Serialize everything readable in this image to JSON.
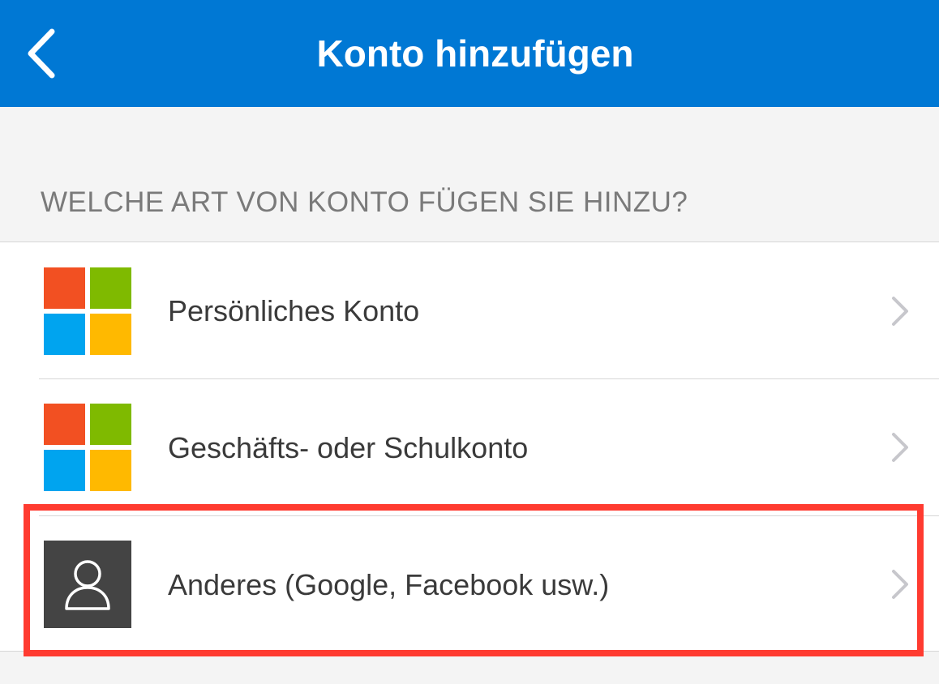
{
  "header": {
    "title": "Konto hinzufügen",
    "back_icon": "chevron-left-icon",
    "background_color": "#0078d4"
  },
  "section": {
    "title": "WELCHE ART VON KONTO FÜGEN SIE HINZU?"
  },
  "accounts": [
    {
      "label": "Persönliches Konto",
      "icon": "microsoft-logo-icon"
    },
    {
      "label": "Geschäfts- oder Schulkonto",
      "icon": "microsoft-logo-icon"
    },
    {
      "label": "Anderes (Google, Facebook usw.)",
      "icon": "person-icon",
      "highlighted": true
    }
  ],
  "colors": {
    "ms_red": "#f25022",
    "ms_green": "#7fba00",
    "ms_blue": "#00a4ef",
    "ms_yellow": "#ffb900",
    "highlight_border": "#ff3b30"
  }
}
